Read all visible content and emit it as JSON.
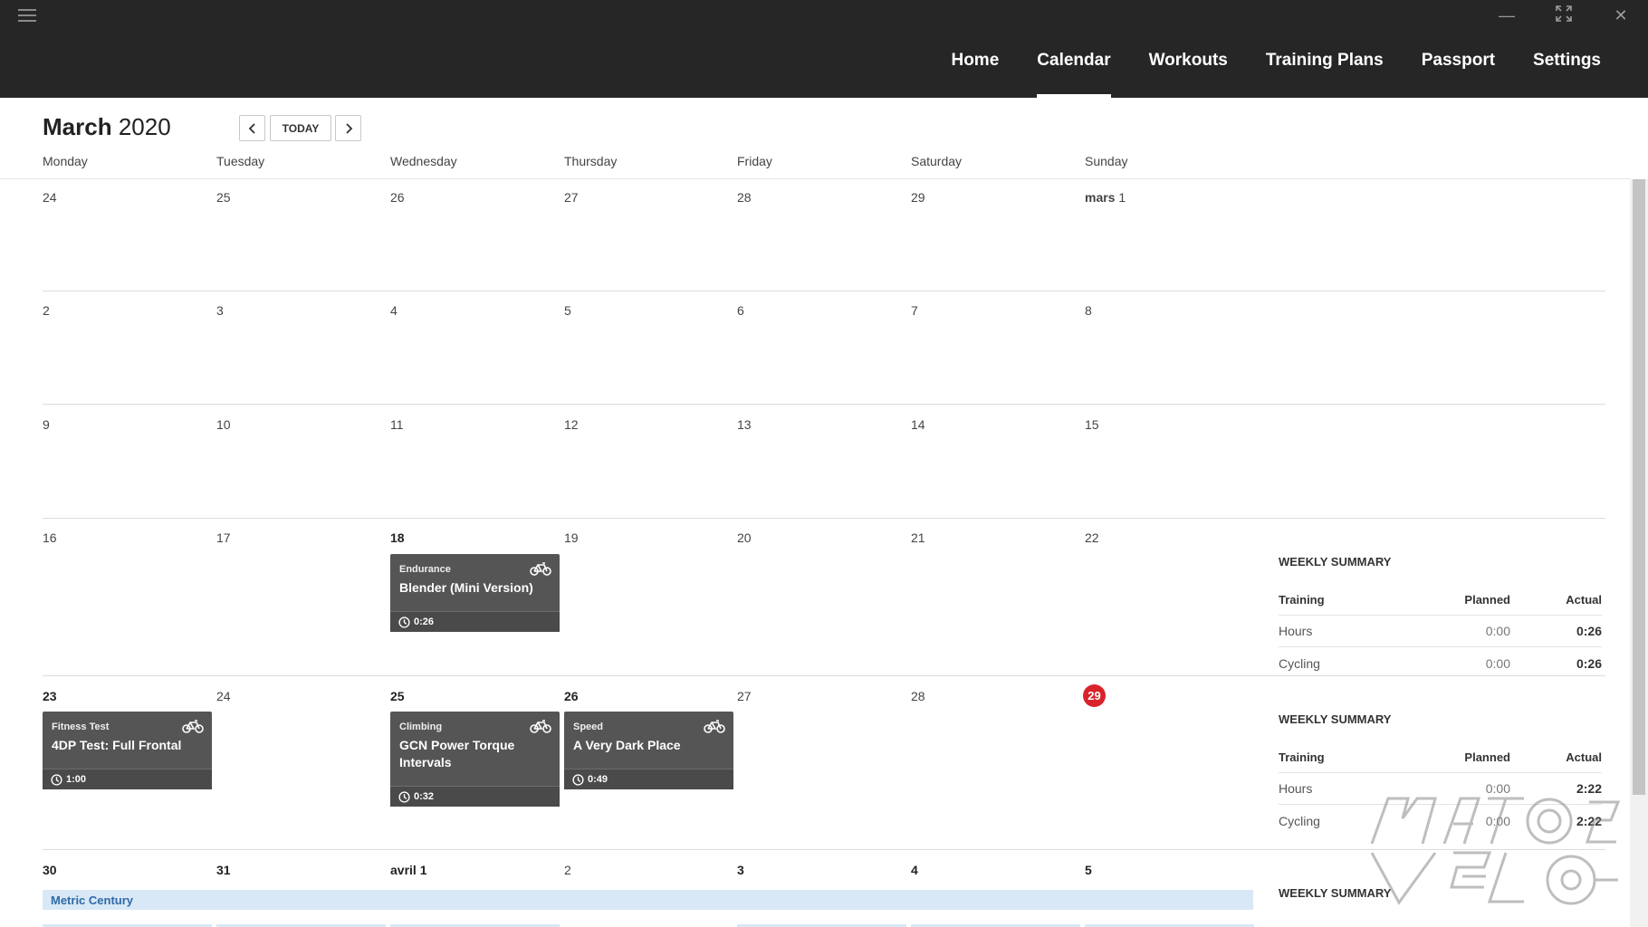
{
  "nav": {
    "items": [
      "Home",
      "Calendar",
      "Workouts",
      "Training Plans",
      "Passport",
      "Settings"
    ],
    "active": "Calendar"
  },
  "header": {
    "month": "March",
    "year": "2020",
    "today_label": "TODAY"
  },
  "days_of_week": [
    "Monday",
    "Tuesday",
    "Wednesday",
    "Thursday",
    "Friday",
    "Saturday",
    "Sunday"
  ],
  "weeks": [
    {
      "days": [
        "24",
        "25",
        "26",
        "27",
        "28",
        "29",
        "1"
      ],
      "sunday_prefix": "mars"
    },
    {
      "days": [
        "2",
        "3",
        "4",
        "5",
        "6",
        "7",
        "8"
      ]
    },
    {
      "days": [
        "9",
        "10",
        "11",
        "12",
        "13",
        "14",
        "15"
      ]
    },
    {
      "days": [
        "16",
        "17",
        "18",
        "19",
        "20",
        "21",
        "22"
      ]
    },
    {
      "days": [
        "23",
        "24",
        "25",
        "26",
        "27",
        "28",
        "29"
      ]
    },
    {
      "days": [
        "30",
        "31",
        "1",
        "2",
        "3",
        "4",
        "5"
      ],
      "wednesday_prefix": "avril"
    }
  ],
  "workouts": [
    {
      "category": "Endurance",
      "name": "Blender (Mini Version)",
      "duration": "0:26"
    },
    {
      "category": "Fitness Test",
      "name": "4DP Test: Full Frontal",
      "duration": "1:00"
    },
    {
      "category": "Climbing",
      "name": "GCN Power Torque Intervals",
      "duration": "0:32"
    },
    {
      "category": "Speed",
      "name": "A Very Dark Place",
      "duration": "0:49"
    }
  ],
  "weekly_summaries": [
    {
      "title": "WEEKLY SUMMARY",
      "headers": [
        "Training",
        "Planned",
        "Actual"
      ],
      "rows": [
        {
          "label": "Hours",
          "planned": "0:00",
          "actual": "0:26"
        },
        {
          "label": "Cycling",
          "planned": "0:00",
          "actual": "0:26"
        }
      ]
    },
    {
      "title": "WEEKLY SUMMARY",
      "headers": [
        "Training",
        "Planned",
        "Actual"
      ],
      "rows": [
        {
          "label": "Hours",
          "planned": "0:00",
          "actual": "2:22"
        },
        {
          "label": "Cycling",
          "planned": "0:00",
          "actual": "2:22"
        }
      ]
    },
    {
      "title": "WEEKLY SUMMARY"
    }
  ],
  "event": {
    "name": "Metric Century"
  },
  "colors": {
    "topbar": "#262626",
    "card": "#555555",
    "today_badge": "#d9232b",
    "event_bg": "#d8e8f6",
    "event_text": "#2f6aa7"
  },
  "icons": {
    "menu": "hamburger-icon",
    "minimize": "minimize-icon",
    "fullscreen": "fullscreen-icon",
    "close": "close-icon",
    "prev": "chevron-left-icon",
    "next": "chevron-right-icon",
    "bike": "bike-icon",
    "clock": "clock-icon"
  }
}
